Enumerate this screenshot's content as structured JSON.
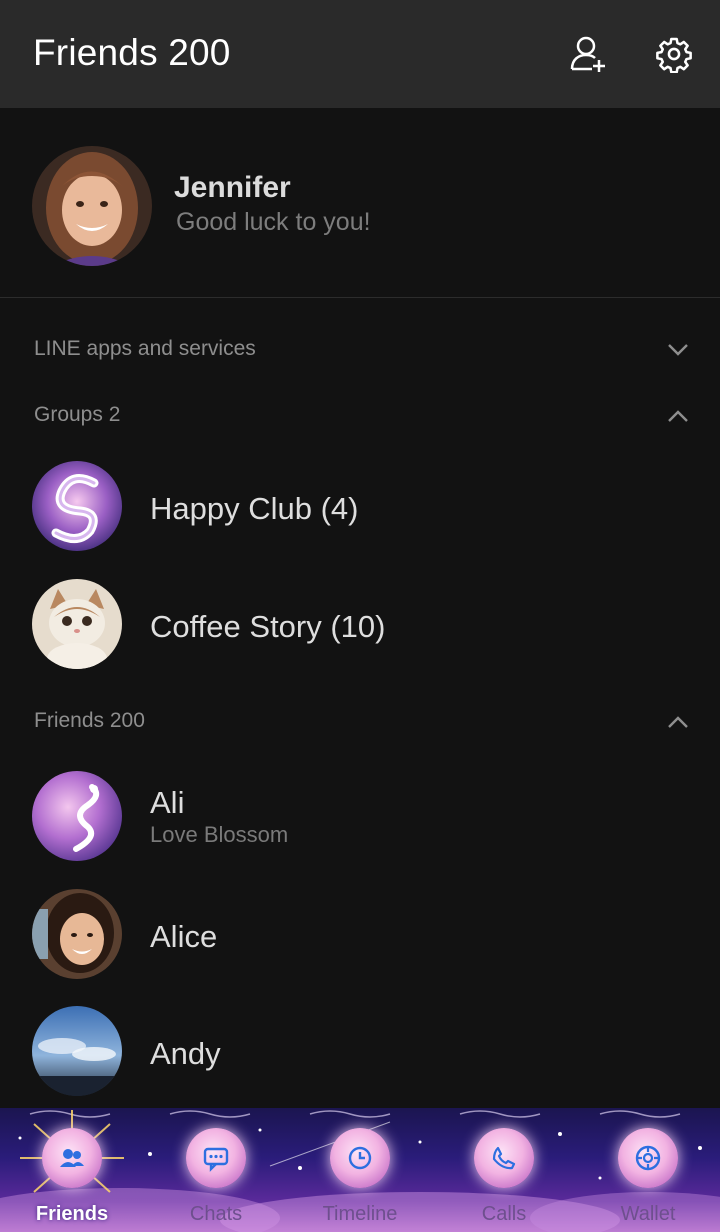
{
  "header": {
    "title": "Friends 200",
    "add_friend_icon": "add-user-icon",
    "settings_icon": "gear-icon"
  },
  "profile": {
    "name": "Jennifer",
    "status": "Good luck to you!"
  },
  "sections": {
    "services": {
      "label": "LINE apps and services",
      "state": "collapsed"
    },
    "groups": {
      "label": "Groups 2",
      "state": "expanded"
    },
    "friends": {
      "label": "Friends 200",
      "state": "expanded"
    }
  },
  "groups": [
    {
      "name": "Happy Club (4)"
    },
    {
      "name": "Coffee Story (10)"
    }
  ],
  "friends": [
    {
      "name": "Ali",
      "status": "Love Blossom"
    },
    {
      "name": "Alice",
      "status": ""
    },
    {
      "name": "Andy",
      "status": ""
    }
  ],
  "nav": [
    {
      "label": "Friends",
      "icon": "friends-icon",
      "active": true
    },
    {
      "label": "Chats",
      "icon": "chat-icon",
      "active": false
    },
    {
      "label": "Timeline",
      "icon": "clock-icon",
      "active": false
    },
    {
      "label": "Calls",
      "icon": "phone-icon",
      "active": false
    },
    {
      "label": "Wallet",
      "icon": "wallet-icon",
      "active": false
    }
  ],
  "colors": {
    "header_bg": "#2a2a2a",
    "list_bg": "#121212",
    "nav_accent": "#2d6fe0"
  }
}
